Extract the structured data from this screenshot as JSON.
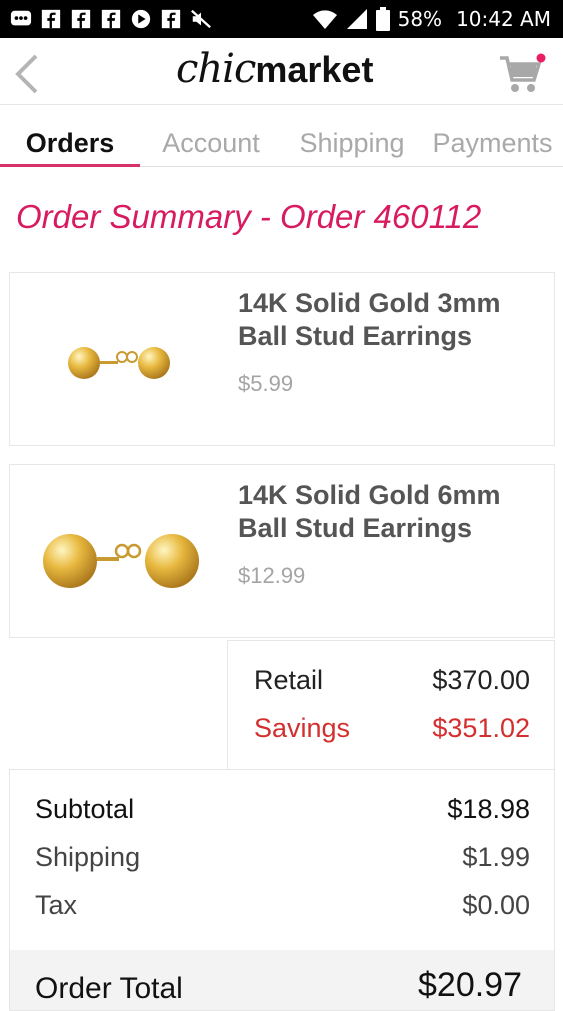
{
  "status_bar": {
    "battery": "58%",
    "time": "10:42 AM",
    "icons": [
      "message-icon",
      "facebook-icon",
      "facebook-icon",
      "facebook-icon",
      "play-icon",
      "facebook-icon",
      "mute-icon",
      "wifi-icon",
      "signal-icon",
      "battery-icon"
    ]
  },
  "header": {
    "logo_part1": "chic",
    "logo_part2": "market",
    "back_icon": "chevron-left-icon",
    "cart_icon": "cart-icon",
    "cart_dot_color": "#e91e63"
  },
  "tabs": [
    {
      "label": "Orders",
      "active": true
    },
    {
      "label": "Account",
      "active": false
    },
    {
      "label": "Shipping",
      "active": false
    },
    {
      "label": "Payments",
      "active": false
    }
  ],
  "order": {
    "title": "Order Summary - Order 460112",
    "items": [
      {
        "name_line1": "14K Solid Gold 3mm",
        "name_line2": "Ball Stud Earrings",
        "price": "$5.99"
      },
      {
        "name_line1": "14K Solid Gold 6mm",
        "name_line2": "Ball Stud Earrings",
        "price": "$12.99"
      }
    ]
  },
  "savings": {
    "retail_label": "Retail",
    "retail_value": "$370.00",
    "savings_label": "Savings",
    "savings_value": "$351.02"
  },
  "totals": {
    "subtotal_label": "Subtotal",
    "subtotal_value": "$18.98",
    "shipping_label": "Shipping",
    "shipping_value": "$1.99",
    "tax_label": "Tax",
    "tax_value": "$0.00",
    "total_label": "Order Total",
    "total_value": "$20.97"
  },
  "colors": {
    "accent": "#d81b60",
    "savings_red": "#d32f2f"
  }
}
